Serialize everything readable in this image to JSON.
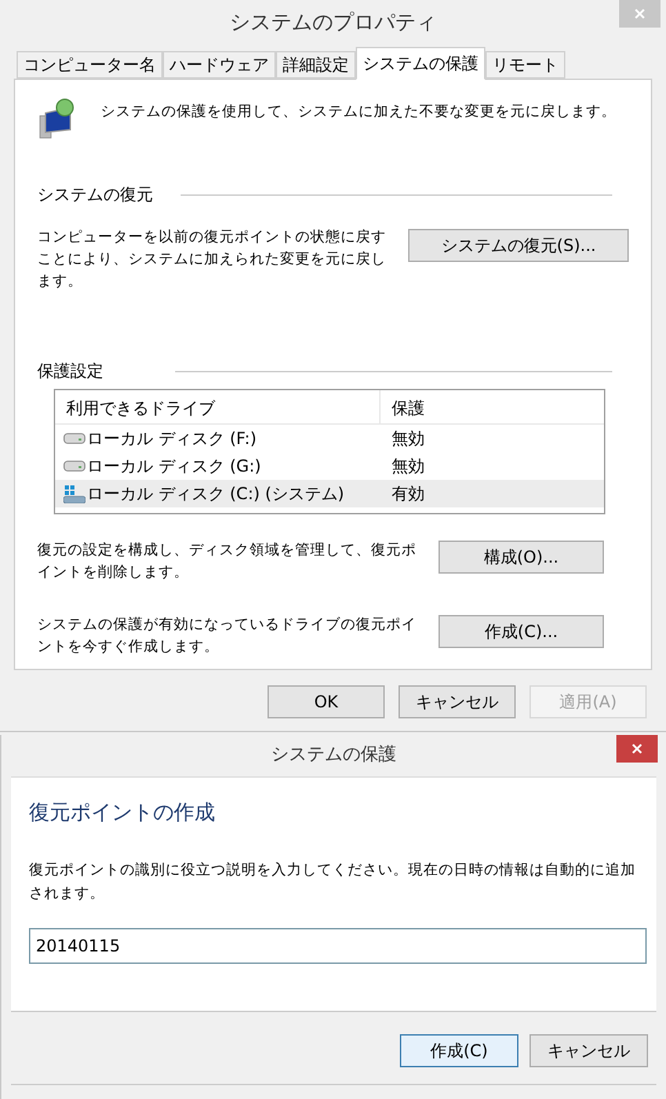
{
  "properties_window": {
    "title": "システムのプロパティ",
    "tabs": [
      {
        "label": "コンピューター名",
        "selected": false
      },
      {
        "label": "ハードウェア",
        "selected": false
      },
      {
        "label": "詳細設定",
        "selected": false
      },
      {
        "label": "システムの保護",
        "selected": true
      },
      {
        "label": "リモート",
        "selected": false
      }
    ],
    "intro": "システムの保護を使用して、システムに加えた不要な変更を元に戻します。",
    "restore_section": {
      "heading": "システムの復元",
      "description": "コンピューターを以前の復元ポイントの状態に戻すことにより、システムに加えられた変更を元に戻します。",
      "button": "システムの復元(S)..."
    },
    "protection_section": {
      "heading": "保護設定",
      "columns": [
        "利用できるドライブ",
        "保護"
      ],
      "drives": [
        {
          "name": "ローカル ディスク (F:)",
          "protection": "無効",
          "kind": "drive",
          "selected": false
        },
        {
          "name": "ローカル ディスク (G:)",
          "protection": "無効",
          "kind": "drive",
          "selected": false
        },
        {
          "name": "ローカル ディスク (C:) (システム)",
          "protection": "有効",
          "kind": "system",
          "selected": true
        }
      ],
      "actions": [
        {
          "text": "復元の設定を構成し、ディスク領域を管理して、復元ポイントを削除します。",
          "button": "構成(O)..."
        },
        {
          "text": "システムの保護が有効になっているドライブの復元ポイントを今すぐ作成します。",
          "button": "作成(C)..."
        }
      ]
    },
    "buttons": [
      {
        "label": "OK",
        "disabled": false
      },
      {
        "label": "キャンセル",
        "disabled": false
      },
      {
        "label": "適用(A)",
        "disabled": true
      }
    ]
  },
  "create_dialog": {
    "title": "システムの保護",
    "heading": "復元ポイントの作成",
    "prompt": "復元ポイントの識別に役立つ説明を入力してください。現在の日時の情報は自動的に追加されます。",
    "description_value": "20140115",
    "buttons": [
      {
        "label": "作成(C)",
        "default": true
      },
      {
        "label": "キャンセル",
        "default": false
      }
    ]
  }
}
